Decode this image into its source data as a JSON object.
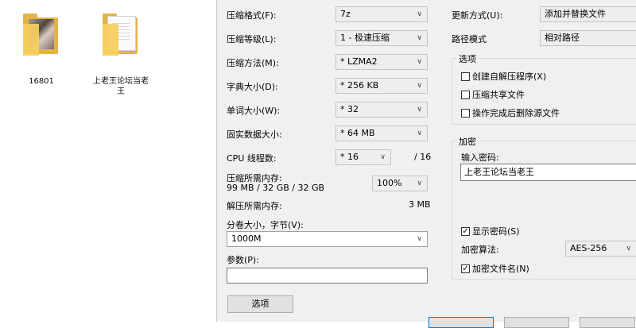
{
  "desktop": {
    "items": [
      {
        "label": "16801",
        "icon": "folder-with-photo-icon"
      },
      {
        "label": "上老王论坛当老\n王",
        "icon": "folder-with-documents-icon"
      }
    ]
  },
  "dialog": {
    "left": {
      "format_label": "压缩格式(F):",
      "format_value": "7z",
      "level_label": "压缩等级(L):",
      "level_value": "1 - 极速压缩",
      "method_label": "压缩方法(M):",
      "method_value": "* LZMA2",
      "dict_label": "字典大小(D):",
      "dict_value": "* 256 KB",
      "word_label": "单词大小(W):",
      "word_value": "* 32",
      "solid_label": "固实数据大小:",
      "solid_value": "* 64 MB",
      "threads_label": "CPU 线程数:",
      "threads_value": "* 16",
      "threads_max": "/ 16",
      "mem_comp_label": "压缩所需内存:",
      "mem_comp_value": "99 MB / 32 GB / 32 GB",
      "mem_pct": "100%",
      "mem_decomp_label": "解压所需内存:",
      "mem_decomp_value": "3 MB",
      "split_label": "分卷大小，字节(V):",
      "split_value": "1000M",
      "params_label": "参数(P):",
      "params_value": "",
      "options_button": "选项"
    },
    "right": {
      "update_label": "更新方式(U):",
      "update_value": "添加并替换文件",
      "path_label": "路径模式",
      "path_value": "相对路径",
      "options_group": "选项",
      "opt_sfx": "创建自解压程序(X)",
      "opt_shared": "压缩共享文件",
      "opt_delete": "操作完成后删除源文件",
      "encrypt_group": "加密",
      "password_label": "输入密码:",
      "password_value": "上老王论坛当老王",
      "show_password": "显示密码(S)",
      "enc_method_label": "加密算法:",
      "enc_method_value": "AES-256",
      "encrypt_names": "加密文件名(N)"
    }
  }
}
